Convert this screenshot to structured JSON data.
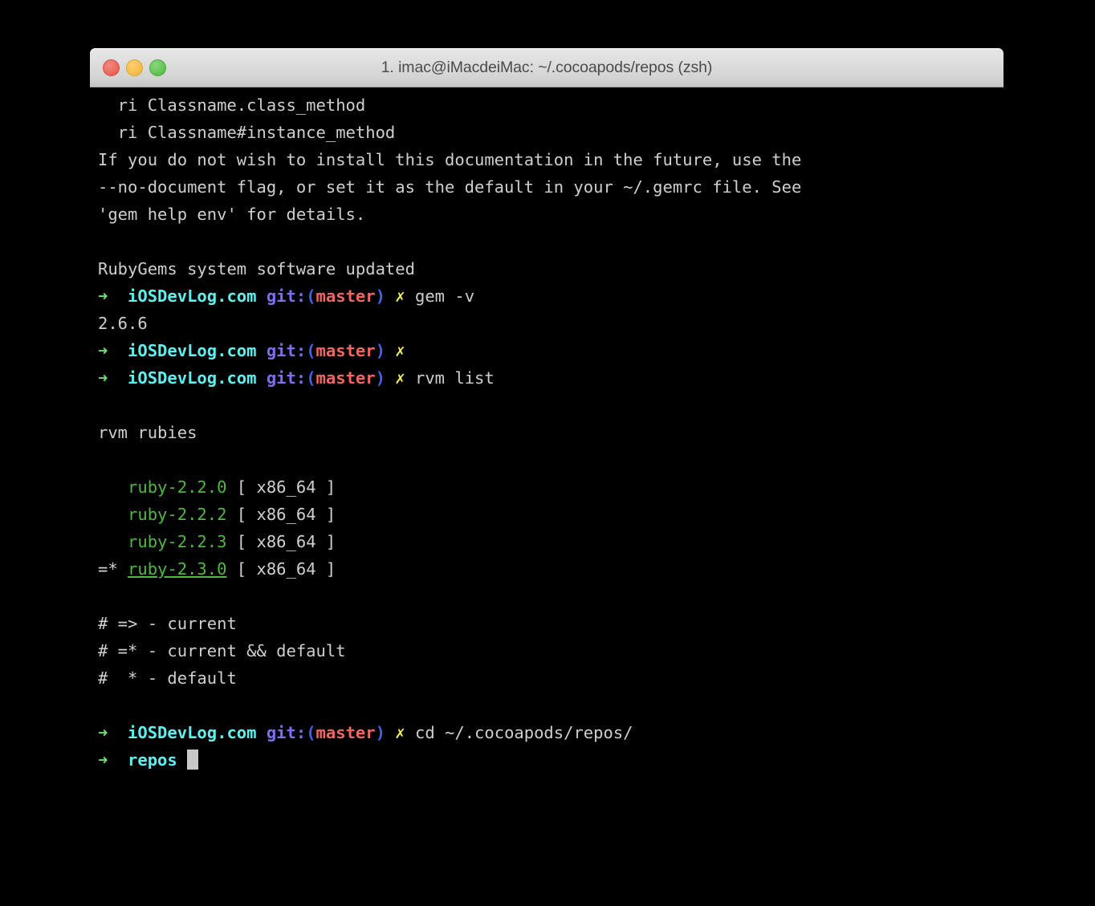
{
  "window": {
    "title": "1. imac@iMacdeiMac: ~/.cocoapods/repos (zsh)",
    "traffic_lights": {
      "close_label": "close",
      "minimize_label": "minimize",
      "zoom_label": "zoom"
    },
    "background_color": "#000000",
    "titlebar_color": "#dcdcdc"
  },
  "theme": {
    "foreground": "#cfcfcf",
    "background": "#000000",
    "prompt_arrow": "#6ee06e",
    "prompt_host": "#5ef0ee",
    "git_keyword": "#7b6ef0",
    "git_paren": "#4a5fe8",
    "git_branch": "#f0675e",
    "status_cross": "#f3ef55",
    "ruby_green": "#4fb83f",
    "cursor": "#c8c8c8"
  },
  "prompt": {
    "arrow": "➜",
    "host": "iOSDevLog.com",
    "git_keyword": "git:",
    "paren_open": "(",
    "branch": "master",
    "paren_close": ")",
    "cross": "✗"
  },
  "terminal": {
    "gem_doc_help": {
      "line1": "  ri Classname.class_method",
      "line2": "  ri Classname#instance_method",
      "line3": "If you do not wish to install this documentation in the future, use the",
      "line4": "--no-document flag, or set it as the default in your ~/.gemrc file. See",
      "line5": "'gem help env' for details."
    },
    "rubygems_updated": "RubyGems system software updated",
    "commands": {
      "gem_version": "gem -v",
      "gem_version_output": "2.6.6",
      "empty_command": "",
      "rvm_list": "rvm list",
      "cd_repos": "cd ~/.cocoapods/repos/"
    },
    "rvm": {
      "header": "rvm rubies",
      "rubies": [
        {
          "marker": "   ",
          "name": "ruby-2.2.0",
          "arch": " [ x86_64 ]",
          "current": false
        },
        {
          "marker": "   ",
          "name": "ruby-2.2.2",
          "arch": " [ x86_64 ]",
          "current": false
        },
        {
          "marker": "   ",
          "name": "ruby-2.2.3",
          "arch": " [ x86_64 ]",
          "current": false
        },
        {
          "marker": "=* ",
          "name": "ruby-2.3.0",
          "arch": " [ x86_64 ]",
          "current": true
        }
      ],
      "legend": [
        "# => - current",
        "# =* - current && default",
        "#  * - default"
      ]
    },
    "final_prompt": {
      "arrow": "➜",
      "dir": "repos"
    }
  }
}
